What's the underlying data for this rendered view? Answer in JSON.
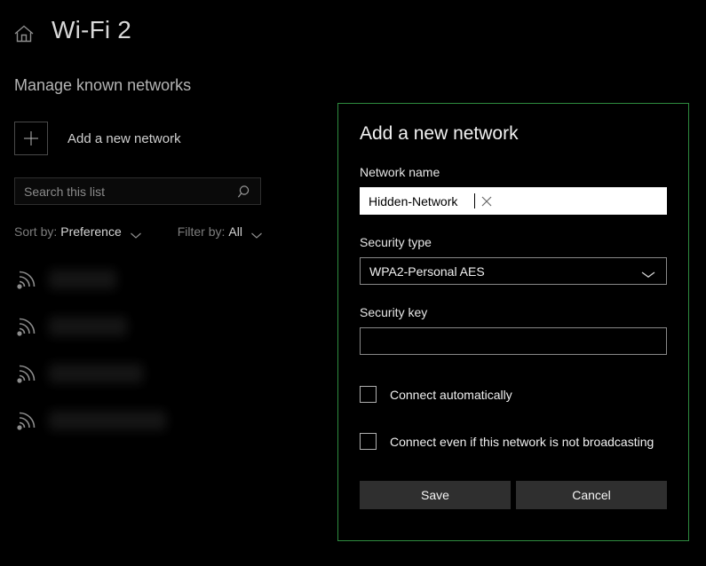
{
  "header": {
    "home_icon": "home-icon",
    "title": "Wi-Fi 2",
    "subtitle": "Manage known networks"
  },
  "sidebar": {
    "add_network": {
      "icon": "plus-icon",
      "label": "Add a new network"
    },
    "search": {
      "placeholder": "Search this list",
      "value": "",
      "icon": "search-icon"
    },
    "sort": {
      "prefix": "Sort by:",
      "value": "Preference",
      "icon": "chevron-down-icon"
    },
    "filter": {
      "prefix": "Filter by:",
      "value": "All",
      "icon": "chevron-down-icon"
    },
    "networks": [
      {
        "icon": "wifi-icon",
        "name": "",
        "redacted_width": 76
      },
      {
        "icon": "wifi-icon",
        "name": "",
        "redacted_width": 88
      },
      {
        "icon": "wifi-icon",
        "name": "",
        "redacted_width": 106
      },
      {
        "icon": "wifi-icon",
        "name": "",
        "redacted_width": 132
      }
    ]
  },
  "dialog": {
    "title": "Add a new network",
    "accent_color": "#2e8b3f",
    "network_name": {
      "label": "Network name",
      "value": "Hidden-Network",
      "placeholder": "",
      "clear_icon": "close-icon"
    },
    "security_type": {
      "label": "Security type",
      "value": "WPA2-Personal AES",
      "icon": "chevron-down-icon"
    },
    "security_key": {
      "label": "Security key",
      "value": "",
      "placeholder": ""
    },
    "checkboxes": [
      {
        "label": "Connect automatically",
        "checked": false
      },
      {
        "label": "Connect even if this network is not broadcasting",
        "checked": false
      }
    ],
    "save_label": "Save",
    "cancel_label": "Cancel"
  }
}
